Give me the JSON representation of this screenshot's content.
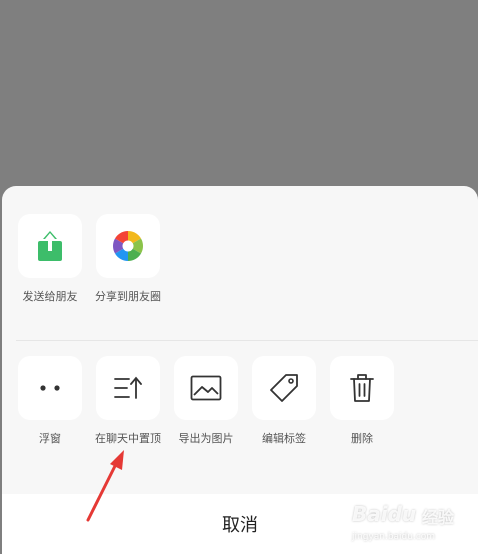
{
  "share_row": {
    "items": [
      {
        "label": "发送给朋友",
        "icon": "send-to-friend-icon"
      },
      {
        "label": "分享到朋友圈",
        "icon": "moments-icon"
      }
    ]
  },
  "action_row": {
    "items": [
      {
        "label": "浮窗",
        "icon": "float-window-icon"
      },
      {
        "label": "在聊天中置顶",
        "icon": "pin-to-top-icon"
      },
      {
        "label": "导出为图片",
        "icon": "export-image-icon"
      },
      {
        "label": "编辑标签",
        "icon": "tag-icon"
      },
      {
        "label": "删除",
        "icon": "trash-icon"
      }
    ]
  },
  "cancel_label": "取消",
  "watermark": {
    "brand": "Baidu",
    "cn": "经验",
    "url": "jingyan.baidu.com"
  },
  "colors": {
    "overlay": "#7f7f7f",
    "sheet": "#f7f7f7",
    "tile": "#ffffff",
    "send_green": "#3dbd6a",
    "arrow_red": "#e53935"
  }
}
